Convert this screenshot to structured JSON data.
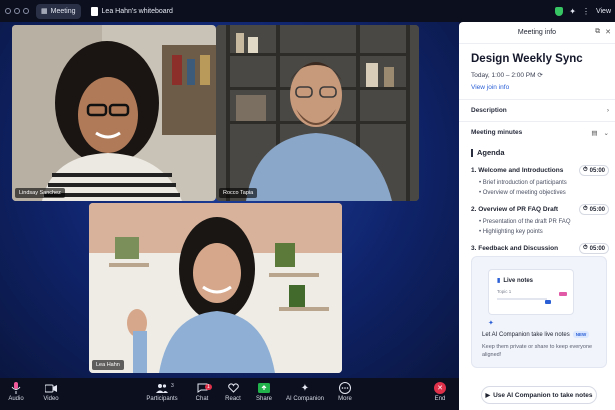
{
  "topbar": {
    "meeting_label": "Meeting",
    "whiteboard_label": "Lea Hahn's whiteboard",
    "view_label": "View"
  },
  "participants": [
    {
      "name": "Lindsay Sanchez"
    },
    {
      "name": "Rocco Tapia"
    },
    {
      "name": "Lea Hahn"
    }
  ],
  "toolbar": {
    "audio": "Audio",
    "video": "Video",
    "participants": "Participants",
    "participants_count": "3",
    "chat": "Chat",
    "chat_badge": "1",
    "react": "React",
    "share": "Share",
    "ai_companion": "AI Companion",
    "more": "More",
    "end": "End"
  },
  "panel": {
    "header": "Meeting info",
    "title": "Design Weekly Sync",
    "time": "Today, 1:00 – 2:00 PM",
    "join_link": "View join info",
    "description_label": "Description",
    "minutes_label": "Meeting minutes",
    "agenda_label": "Agenda",
    "agenda": [
      {
        "title": "1. Welcome and Introductions",
        "duration": "05:00",
        "subs": [
          "• Brief introduction of participants",
          "• Overview of meeting objectives"
        ]
      },
      {
        "title": "2. Overview of PR FAQ Draft",
        "duration": "05:00",
        "subs": [
          "• Presentation of the draft PR FAQ",
          "• Highlighting key points"
        ]
      },
      {
        "title": "3. Feedback and Discussion",
        "duration": "05:00",
        "subs": []
      }
    ],
    "ai_card": {
      "live_notes": "Live notes",
      "topic": "Topic 1",
      "headline": "Let AI Companion take live notes",
      "new_badge": "NEW",
      "sub": "Keep them private or share to keep everyone aligned!"
    },
    "ai_button": "Use AI Companion to take notes"
  },
  "colors": {
    "stage": "#0f236a",
    "bar": "#0b0f1e",
    "accent": "#2a5fd6",
    "end": "#e0314b"
  }
}
